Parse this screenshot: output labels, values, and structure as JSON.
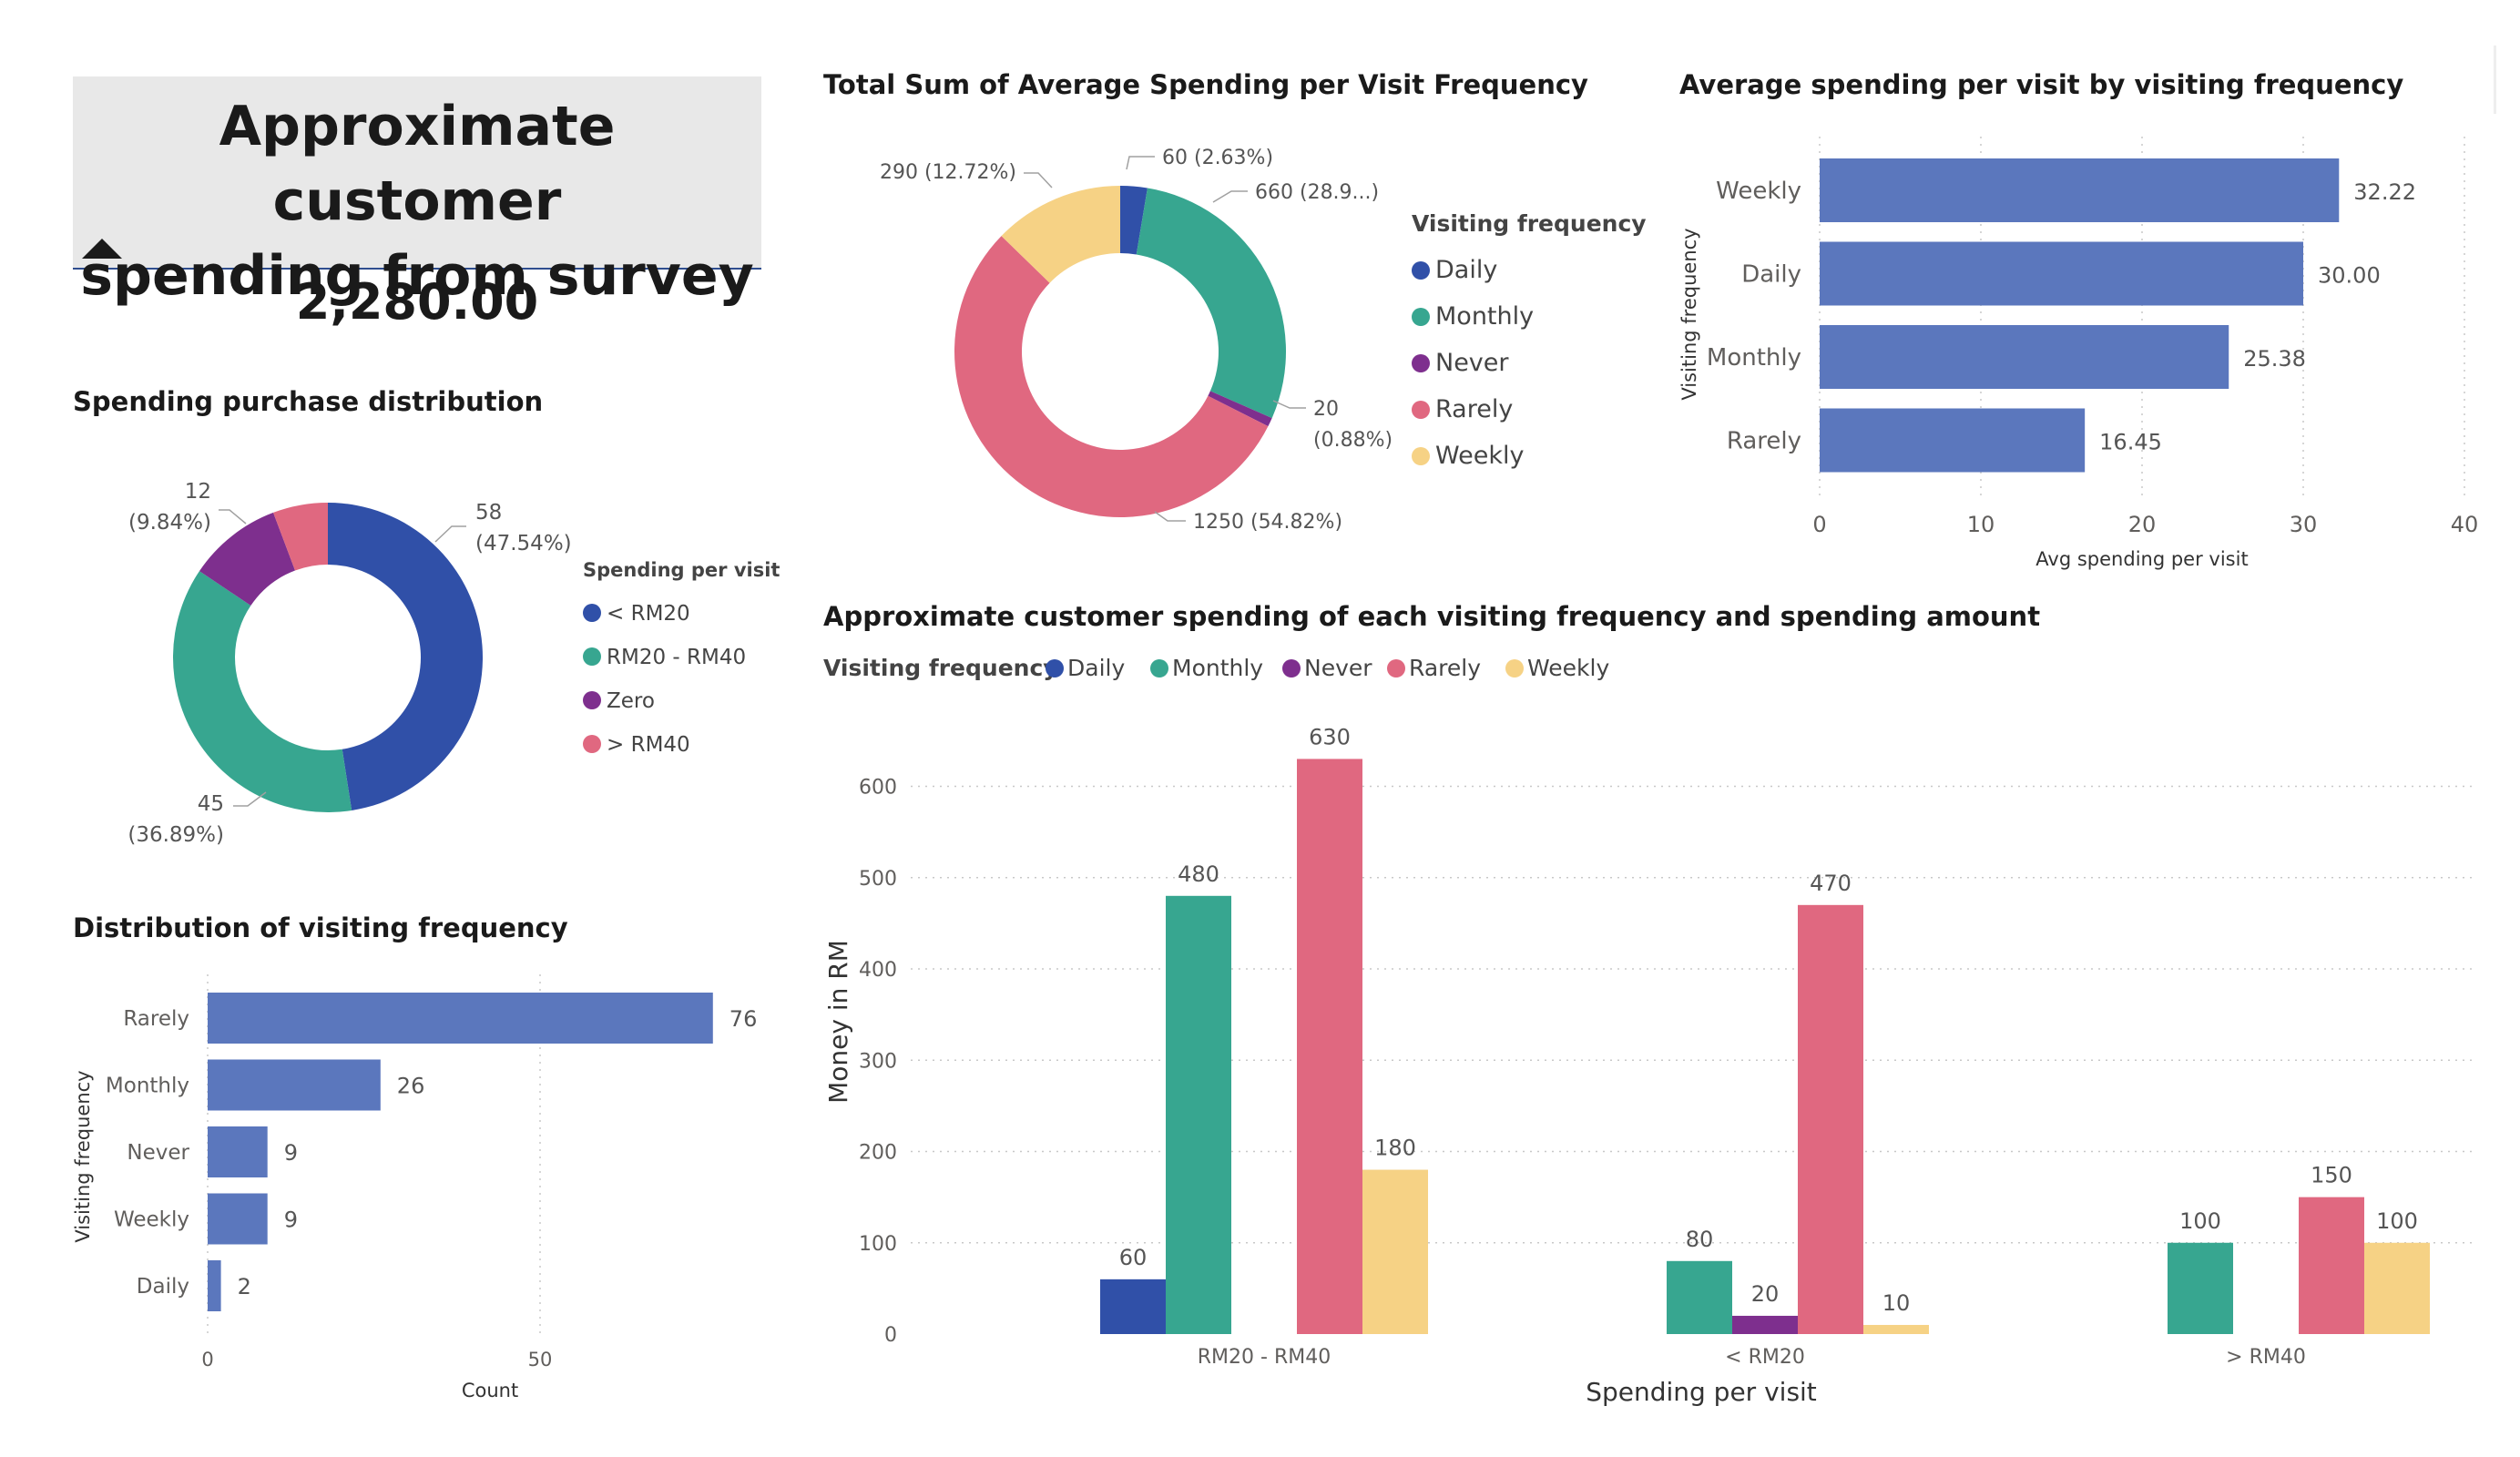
{
  "header": {
    "title": "Approximate customer\nspending from survey",
    "kpi_value": "2,280.00"
  },
  "colors": {
    "daily": "#3050a8",
    "monthly": "#37a690",
    "never": "#7e2f8e",
    "rarely": "#e06880",
    "weekly": "#f6d285",
    "bar": "#5b77bd",
    "grid": "#c8c8c8",
    "axis_text": "#605e5c"
  },
  "chart_data": [
    {
      "id": "spending_distribution",
      "type": "pie",
      "title": "Spending purchase distribution",
      "legend_title": "Spending per visit",
      "legend_position": "right",
      "slices": [
        {
          "label": "< RM20",
          "value": 58,
          "percent_label": "(47.54%)",
          "color": "#3050a8"
        },
        {
          "label": "RM20 - RM40",
          "value": 45,
          "percent_label": "(36.89%)",
          "color": "#37a690"
        },
        {
          "label": "Zero",
          "value": 12,
          "percent_label": "(9.84%)",
          "color": "#7e2f8e"
        },
        {
          "label": "> RM40",
          "value": 7,
          "percent_label": "",
          "color": "#e06880"
        }
      ]
    },
    {
      "id": "visit_distribution",
      "type": "bar",
      "orientation": "horizontal",
      "title": "Distribution of visiting frequency",
      "xlabel": "Count",
      "ylabel": "Visiting frequency",
      "categories": [
        "Rarely",
        "Monthly",
        "Never",
        "Weekly",
        "Daily"
      ],
      "values": [
        76,
        26,
        9,
        9,
        2
      ],
      "xlim": [
        0,
        90
      ],
      "xticks": [
        0,
        50
      ],
      "grid": true
    },
    {
      "id": "total_spending_donut",
      "type": "pie",
      "title": "Total Sum of Average Spending per Visit Frequency",
      "legend_title": "Visiting frequency",
      "legend_position": "right",
      "slices": [
        {
          "label": "Daily",
          "value": 60,
          "label_text": "60 (2.63%)",
          "color": "#3050a8"
        },
        {
          "label": "Monthly",
          "value": 660,
          "label_text": "660 (28.9...)",
          "color": "#37a690"
        },
        {
          "label": "Never",
          "value": 20,
          "label_text": "20",
          "label_text2": "(0.88%)",
          "color": "#7e2f8e"
        },
        {
          "label": "Rarely",
          "value": 1250,
          "label_text": "1250 (54.82%)",
          "color": "#e06880"
        },
        {
          "label": "Weekly",
          "value": 290,
          "label_text": "290 (12.72%)",
          "color": "#f6d285"
        }
      ]
    },
    {
      "id": "avg_spending_bar",
      "type": "bar",
      "orientation": "horizontal",
      "title": "Average spending per visit by visiting frequency",
      "xlabel": "Avg spending per visit",
      "ylabel": "Visiting frequency",
      "categories": [
        "Weekly",
        "Daily",
        "Monthly",
        "Rarely"
      ],
      "values": [
        32.22,
        30.0,
        25.38,
        16.45
      ],
      "value_labels": [
        "32.22",
        "30.00",
        "25.38",
        "16.45"
      ],
      "xlim": [
        0,
        40
      ],
      "xticks": [
        0,
        10,
        20,
        30,
        40
      ],
      "grid": true
    },
    {
      "id": "clustered_spending",
      "type": "bar",
      "title": "Approximate customer spending of each visiting frequency and spending amount",
      "legend_title": "Visiting frequency",
      "legend_position": "top-left",
      "xlabel": "Spending per visit",
      "ylabel": "Money in RM",
      "categories": [
        "RM20 - RM40",
        "< RM20",
        "> RM40"
      ],
      "ylim": [
        0,
        650
      ],
      "yticks": [
        0,
        100,
        200,
        300,
        400,
        500,
        600
      ],
      "grid": true,
      "series": [
        {
          "name": "Daily",
          "color": "#3050a8",
          "values": [
            60,
            null,
            null
          ]
        },
        {
          "name": "Monthly",
          "color": "#37a690",
          "values": [
            480,
            80,
            100
          ]
        },
        {
          "name": "Never",
          "color": "#7e2f8e",
          "values": [
            null,
            20,
            null
          ]
        },
        {
          "name": "Rarely",
          "color": "#e06880",
          "values": [
            630,
            470,
            150
          ]
        },
        {
          "name": "Weekly",
          "color": "#f6d285",
          "values": [
            180,
            10,
            100
          ]
        }
      ]
    }
  ]
}
